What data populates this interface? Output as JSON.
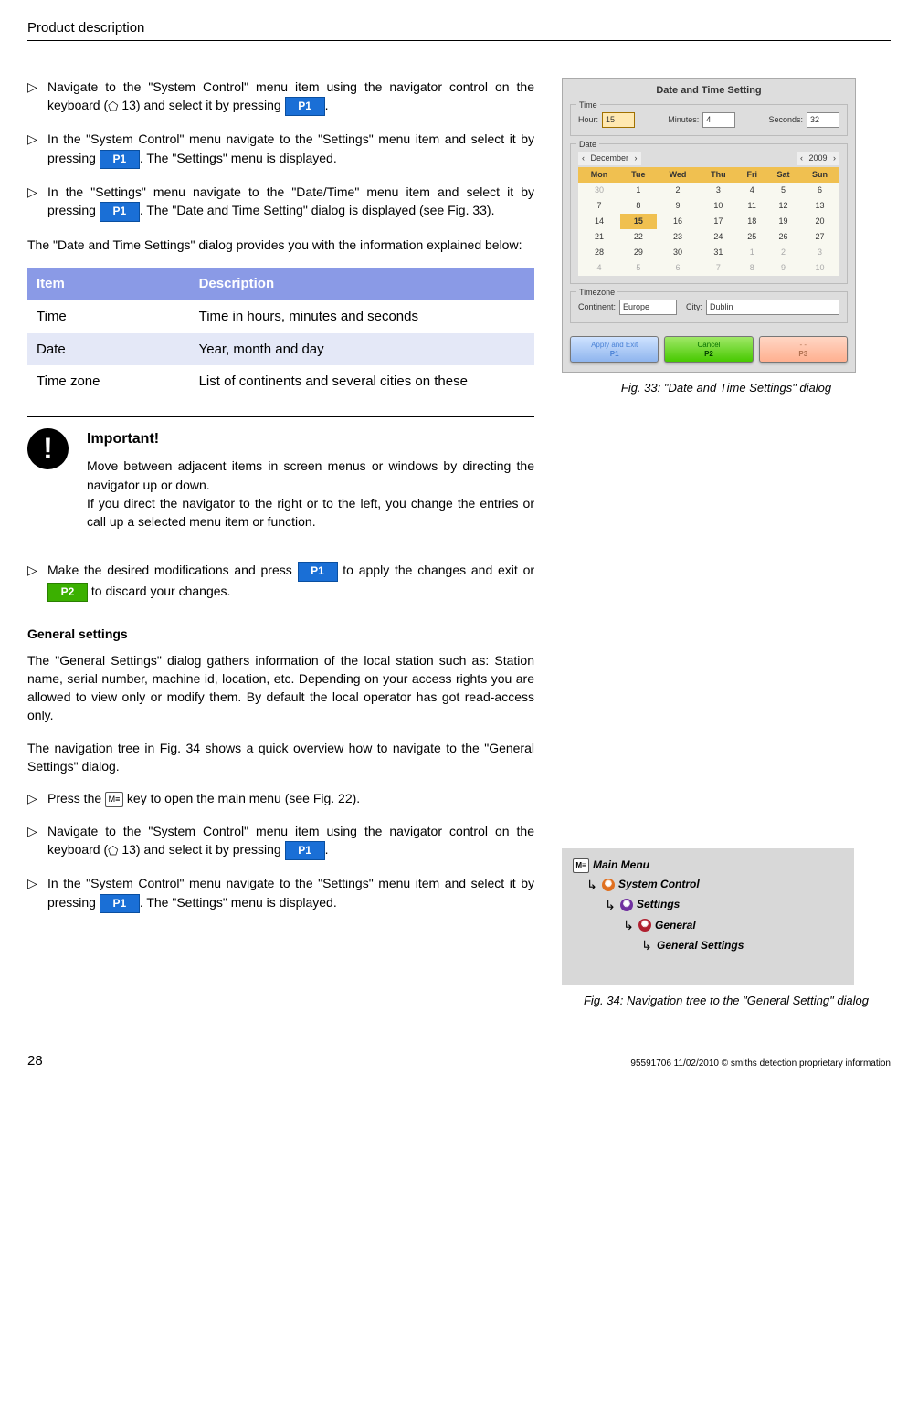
{
  "header": "Product description",
  "steps_a": [
    {
      "pre": "Navigate to the \"System Control\" menu item using the navigator control on the keyboard (",
      "nav": "⬠",
      "navref": "13) and select it by pressing ",
      "btn": "P1",
      "post": "."
    },
    {
      "pre": "In the \"System Control\" menu navigate to the \"Settings\" menu item and select it by pressing ",
      "btn": "P1",
      "post": ". The \"Settings\" menu is displayed."
    },
    {
      "pre": "In the \"Settings\" menu navigate to the \"Date/Time\" menu item and select it by pressing ",
      "btn": "P1",
      "post": ". The \"Date and Time Setting\" dialog is displayed (see Fig. 33)."
    }
  ],
  "para1": "The \"Date and Time Settings\" dialog provides you with the information explained below:",
  "table": {
    "headers": [
      "Item",
      "Description"
    ],
    "rows": [
      [
        "Time",
        "Time in hours, minutes and seconds"
      ],
      [
        "Date",
        "Year, month and day"
      ],
      [
        "Time zone",
        "List of continents and several cities on these"
      ]
    ]
  },
  "important": {
    "title": "Important!",
    "p1": "Move between adjacent items in screen menus or windows by directing the navigator up or down.",
    "p2": "If you direct the navigator to the right or to the left, you change the entries or call up a selected menu item or function."
  },
  "step_apply": {
    "pre": "Make the desired modifications and press ",
    "b1": "P1",
    "mid": " to apply the changes and exit or ",
    "b2": "P2",
    "post": " to discard your changes."
  },
  "general_heading": "General settings",
  "general_p1": "The \"General Settings\" dialog gathers information of the local station such as: Station name, serial number, machine id, location, etc. Depending on your access rights you are allowed to view only or modify them. By default the local operator has got read-access only.",
  "general_p2": "The navigation tree in Fig. 34 shows a quick overview how to navigate to the \"General Settings\" dialog.",
  "steps_b": [
    {
      "key": true,
      "pre": "Press the ",
      "post": " key to open the main menu (see Fig. 22)."
    },
    {
      "pre": "Navigate to the \"System Control\" menu item using the navigator control on the keyboard (",
      "nav": "⬠",
      "navref": "13) and select it by pressing ",
      "btn": "P1",
      "post": "."
    },
    {
      "pre": "In the \"System Control\" menu navigate to the \"Settings\" menu item and select it by pressing ",
      "btn": "P1",
      "post": ". The \"Settings\" menu is displayed."
    }
  ],
  "dialog": {
    "title": "Date and Time Setting",
    "time_label": "Time",
    "hour_l": "Hour:",
    "hour": "15",
    "min_l": "Minutes:",
    "min": "4",
    "sec_l": "Seconds:",
    "sec": "32",
    "date_label": "Date",
    "month": "December",
    "year": "2009",
    "dow": [
      "Mon",
      "Tue",
      "Wed",
      "Thu",
      "Fri",
      "Sat",
      "Sun"
    ],
    "weeks": [
      [
        {
          "d": "30",
          "o": true
        },
        {
          "d": "1"
        },
        {
          "d": "2"
        },
        {
          "d": "3"
        },
        {
          "d": "4"
        },
        {
          "d": "5"
        },
        {
          "d": "6"
        }
      ],
      [
        {
          "d": "7"
        },
        {
          "d": "8"
        },
        {
          "d": "9"
        },
        {
          "d": "10"
        },
        {
          "d": "11"
        },
        {
          "d": "12"
        },
        {
          "d": "13"
        }
      ],
      [
        {
          "d": "14"
        },
        {
          "d": "15",
          "s": true
        },
        {
          "d": "16"
        },
        {
          "d": "17"
        },
        {
          "d": "18"
        },
        {
          "d": "19"
        },
        {
          "d": "20"
        }
      ],
      [
        {
          "d": "21"
        },
        {
          "d": "22"
        },
        {
          "d": "23"
        },
        {
          "d": "24"
        },
        {
          "d": "25"
        },
        {
          "d": "26"
        },
        {
          "d": "27"
        }
      ],
      [
        {
          "d": "28"
        },
        {
          "d": "29"
        },
        {
          "d": "30"
        },
        {
          "d": "31"
        },
        {
          "d": "1",
          "o": true
        },
        {
          "d": "2",
          "o": true
        },
        {
          "d": "3",
          "o": true
        }
      ],
      [
        {
          "d": "4",
          "o": true
        },
        {
          "d": "5",
          "o": true
        },
        {
          "d": "6",
          "o": true
        },
        {
          "d": "7",
          "o": true
        },
        {
          "d": "8",
          "o": true
        },
        {
          "d": "9",
          "o": true
        },
        {
          "d": "10",
          "o": true
        }
      ]
    ],
    "tz_label": "Timezone",
    "continent_l": "Continent:",
    "continent": "Europe",
    "city_l": "City:",
    "city": "Dublin",
    "apply": "Apply and Exit",
    "apply_k": "P1",
    "cancel": "Cancel",
    "cancel_k": "P2",
    "dash": "- -",
    "dash_k": "P3"
  },
  "fig33": "Fig. 33: \"Date and Time Settings\" dialog",
  "navtree": {
    "main": "Main Menu",
    "sys": "System Control",
    "set": "Settings",
    "gen": "General",
    "genset": "General Settings"
  },
  "fig34": "Fig. 34: Navigation tree to the \"General Setting\" dialog",
  "footer_page": "28",
  "footer_right": "95591706 11/02/2010 © smiths detection proprietary information"
}
